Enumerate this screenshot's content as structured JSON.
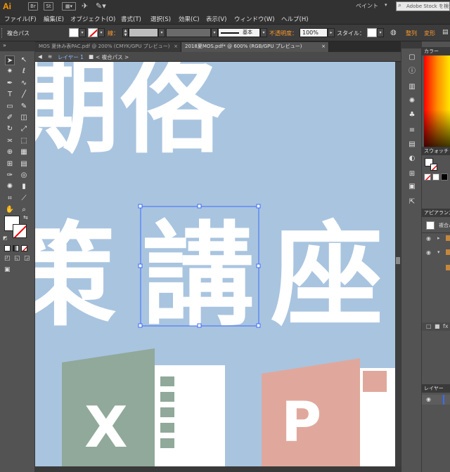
{
  "app": {
    "logo": "Ai",
    "workspace_label": "ペイント",
    "stock_search_placeholder": "Adobe Stock を検索"
  },
  "menu": [
    "ファイル(F)",
    "編集(E)",
    "オブジェクト(O)",
    "書式(T)",
    "選択(S)",
    "効果(C)",
    "表示(V)",
    "ウィンドウ(W)",
    "ヘルプ(H)"
  ],
  "control_bar": {
    "selection_label": "複合パス",
    "stroke_label": "線：",
    "stroke_style": "基本",
    "opacity_label": "不透明度：",
    "opacity_value": "100%",
    "style_label": "スタイル：",
    "align_label": "整列",
    "transform_label": "変形"
  },
  "tabs": [
    {
      "label": "MOS 夏休み表PAC.pdf @ 200% (CMYK/GPU プレビュー)",
      "active": false
    },
    {
      "label": "2018夏MOS.pdf* @ 600% (RGB/GPU プレビュー)",
      "active": true
    }
  ],
  "breadcrumb": {
    "layer": "レイヤー 1",
    "item": "< 複合パス >"
  },
  "canvas": {
    "background": "#a9c4df",
    "big_text_top": "期佫",
    "big_text_row2": [
      "策",
      "講",
      "座"
    ],
    "excel_letter": "X",
    "powerpoint_letter": "P",
    "excel_color": "#90a99a",
    "powerpoint_color": "#e0a89c",
    "selection_color": "#3b6bff"
  },
  "panels": {
    "color_tab": "カラー",
    "swatches_tab": "スウォッチ",
    "appearance_tab": "アピアランス",
    "appearance_item": "複合パス",
    "layers_tab": "レイヤー"
  },
  "tool_icons": [
    "selection-tool-icon",
    "direct-selection-tool-icon",
    "magic-wand-tool-icon",
    "lasso-tool-icon",
    "pen-tool-icon",
    "curvature-tool-icon",
    "type-tool-icon",
    "line-tool-icon",
    "rectangle-tool-icon",
    "paintbrush-tool-icon",
    "shaper-tool-icon",
    "eraser-tool-icon",
    "rotate-tool-icon",
    "scale-tool-icon",
    "width-tool-icon",
    "free-transform-tool-icon",
    "shape-builder-tool-icon",
    "perspective-grid-tool-icon",
    "mesh-tool-icon",
    "gradient-tool-icon",
    "eyedropper-tool-icon",
    "blend-tool-icon",
    "symbol-sprayer-tool-icon",
    "column-graph-tool-icon",
    "artboard-tool-icon",
    "slice-tool-icon",
    "hand-tool-icon",
    "zoom-tool-icon"
  ]
}
